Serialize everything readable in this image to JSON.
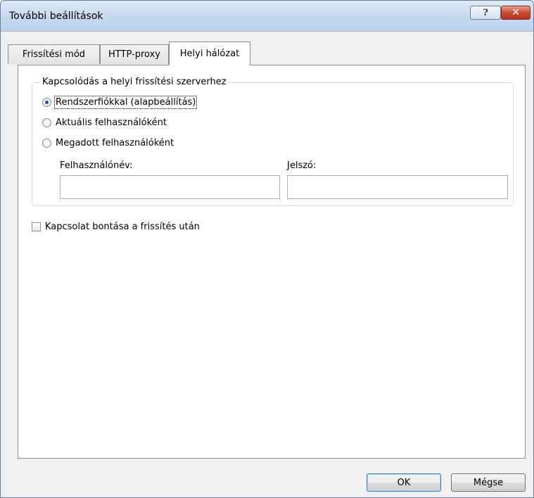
{
  "window": {
    "title": "További beállítások",
    "help_glyph": "?",
    "close_glyph": "✕"
  },
  "tabs": [
    {
      "label": "Frissítési mód",
      "active": false
    },
    {
      "label": "HTTP-proxy",
      "active": false
    },
    {
      "label": "Helyi hálózat",
      "active": true
    }
  ],
  "connection": {
    "group_label": "Kapcsolódás a helyi frissítési szerverhez",
    "options": [
      {
        "label": "Rendszerfiókkal (alapbeállítás)",
        "checked": true
      },
      {
        "label": "Aktuális felhasználóként",
        "checked": false
      },
      {
        "label": "Megadott felhasználóként",
        "checked": false
      }
    ],
    "username_label": "Felhasználónév:",
    "username_value": "",
    "password_label": "Jelszó:",
    "password_value": ""
  },
  "disconnect": {
    "label": "Kapcsolat bontása a frissítés után",
    "checked": false
  },
  "buttons": {
    "ok": "OK",
    "cancel": "Mégse"
  },
  "colors": {
    "titlebar": "#c5d8ef",
    "close_button": "#c84b34",
    "default_button_border": "#3c7fb1"
  }
}
